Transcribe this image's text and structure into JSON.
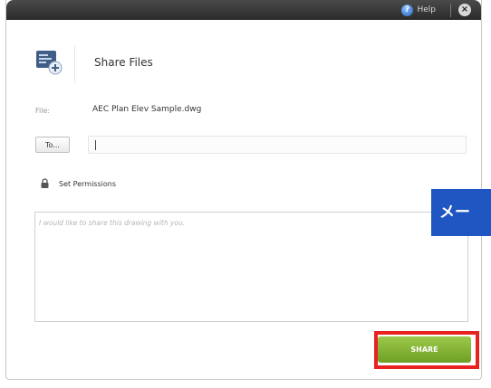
{
  "titlebar": {
    "help_label": "Help",
    "help_icon": "help-icon",
    "close_icon": "close-icon"
  },
  "header": {
    "title": "Share Files",
    "icon": "share-files-icon"
  },
  "file": {
    "label": "File:",
    "name": "AEC Plan Elev Sample.dwg"
  },
  "to": {
    "button_label": "To...",
    "input_value": ""
  },
  "permissions": {
    "label": "Set Permissions",
    "icon": "lock-icon"
  },
  "message": {
    "placeholder": "I would like to share this drawing with you."
  },
  "footer": {
    "share_label": "SHARE"
  },
  "overlay": {
    "side_tab_label": "メー"
  },
  "colors": {
    "title_bar": "#333333",
    "share_button": "#86b53a",
    "highlight": "#e8231f",
    "side_tab": "#1f56c2"
  }
}
